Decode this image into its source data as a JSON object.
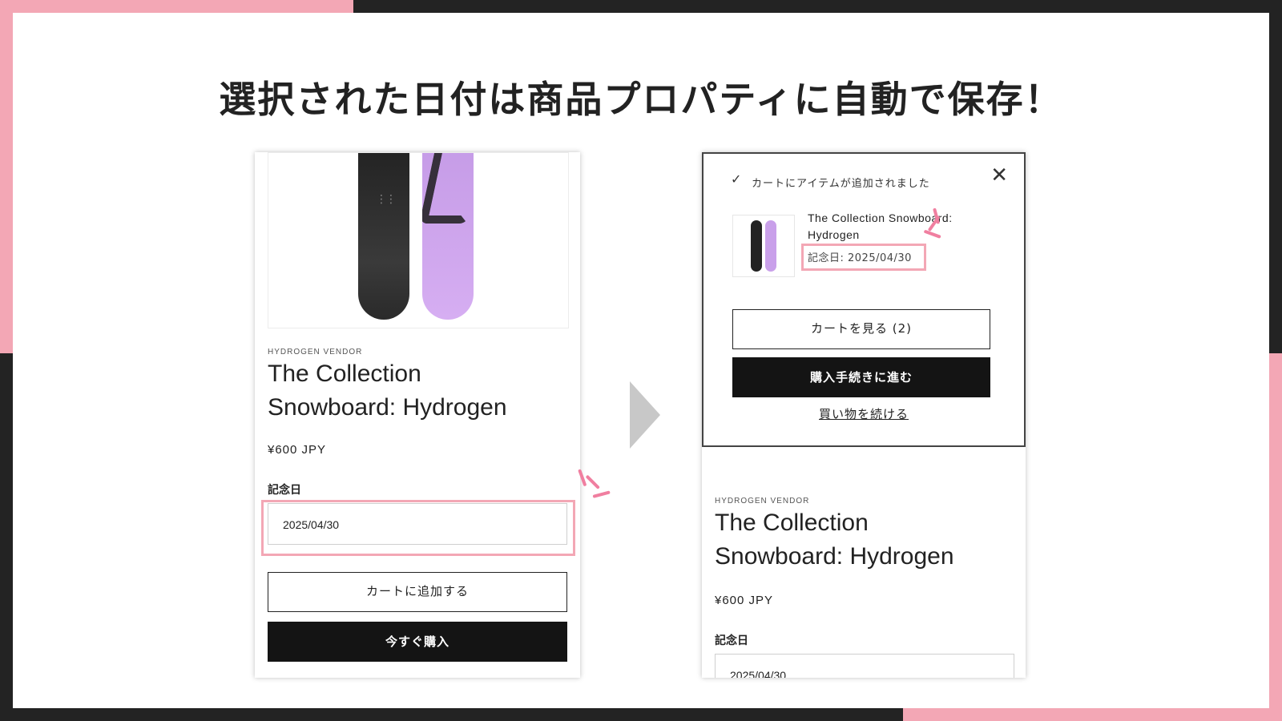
{
  "headline": "選択された日付は商品プロパティに自動で保存！",
  "colors": {
    "accent_pink": "#f3a7b5",
    "spark_pink": "#f07fa0",
    "frame_dark": "#232323",
    "button_dark": "#141414"
  },
  "product_page": {
    "vendor": "HYDROGEN VENDOR",
    "title_line1": "The Collection",
    "title_line2": "Snowboard: Hydrogen",
    "price": "¥600 JPY",
    "field_label": "記念日",
    "date_value": "2025/04/30",
    "add_to_cart_label": "カートに追加する",
    "buy_now_label": "今すぐ購入"
  },
  "cart_popup": {
    "check_icon": "check-icon",
    "status_text": "カートにアイテムが追加されました",
    "close_icon": "close-icon",
    "item_name": "The Collection Snowboard: Hydrogen",
    "item_property": "記念日: 2025/04/30",
    "view_cart_label": "カートを見る (2)",
    "checkout_label": "購入手続きに進む",
    "continue_label": "買い物を続ける"
  }
}
